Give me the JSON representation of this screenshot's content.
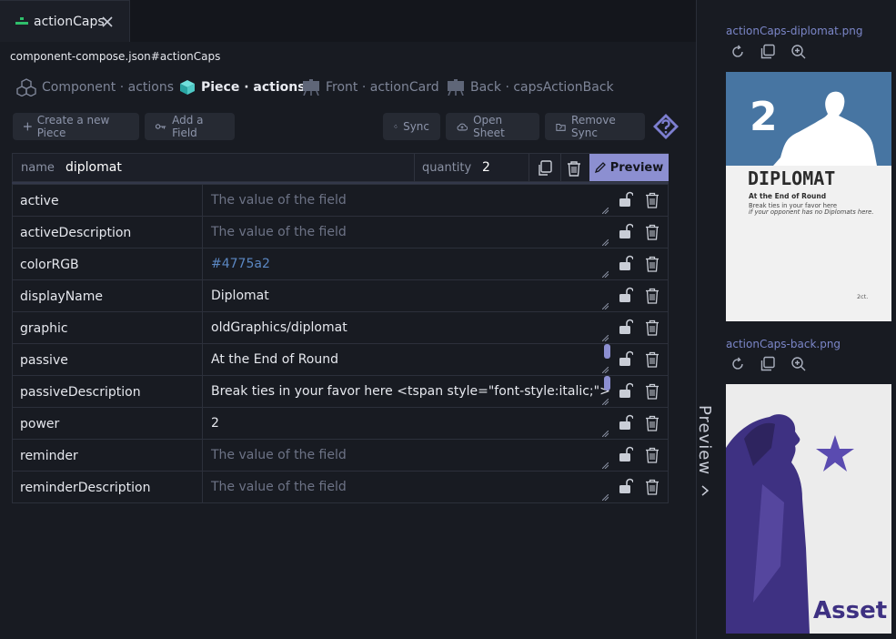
{
  "tab": {
    "title": "actionCaps"
  },
  "path": "component-compose.json#actionCaps",
  "piece_tabs": [
    {
      "label": "Component · actions"
    },
    {
      "label": "Piece · actions"
    },
    {
      "label": "Front · actionCard"
    },
    {
      "label": "Back · capsActionBack"
    }
  ],
  "toolbar": {
    "create": "Create a new Piece",
    "add_field": "Add a Field",
    "sync": "Sync",
    "open_sheet": "Open Sheet",
    "remove_sync": "Remove Sync"
  },
  "piece": {
    "name_label": "name",
    "name_value": "diplomat",
    "quantity_label": "quantity",
    "quantity_value": "2",
    "preview_label": "Preview"
  },
  "fields": [
    {
      "key": "active",
      "value": "",
      "placeholder": "The value of the field"
    },
    {
      "key": "activeDescription",
      "value": "",
      "placeholder": "The value of the field"
    },
    {
      "key": "colorRGB",
      "value": "#4775a2",
      "placeholder": ""
    },
    {
      "key": "displayName",
      "value": "Diplomat",
      "placeholder": ""
    },
    {
      "key": "graphic",
      "value": "oldGraphics/diplomat",
      "placeholder": ""
    },
    {
      "key": "passive",
      "value": "At the End of Round",
      "placeholder": ""
    },
    {
      "key": "passiveDescription",
      "value": "Break ties in your favor here <tspan style=\"font-style:italic;\">if your",
      "placeholder": ""
    },
    {
      "key": "power",
      "value": "2",
      "placeholder": ""
    },
    {
      "key": "reminder",
      "value": "",
      "placeholder": "The value of the field"
    },
    {
      "key": "reminderDescription",
      "value": "",
      "placeholder": "The value of the field"
    }
  ],
  "preview_panel": {
    "label": "Preview",
    "front_file": "actionCaps-diplomat.png",
    "back_file": "actionCaps-back.png",
    "front_card": {
      "number": "2",
      "title": "DIPLOMAT",
      "subtitle": "At the End of Round",
      "body": "Break ties in your favor here",
      "body_italic": "if your opponent has no Diplomats here.",
      "footer": "2ct."
    },
    "back_card": {
      "word": "Asset"
    }
  },
  "colors": {
    "accent": "#8c8fd1",
    "card_blue": "#4775a2",
    "card_back_purple": "#3e3182",
    "star": "#5a4bb0"
  }
}
